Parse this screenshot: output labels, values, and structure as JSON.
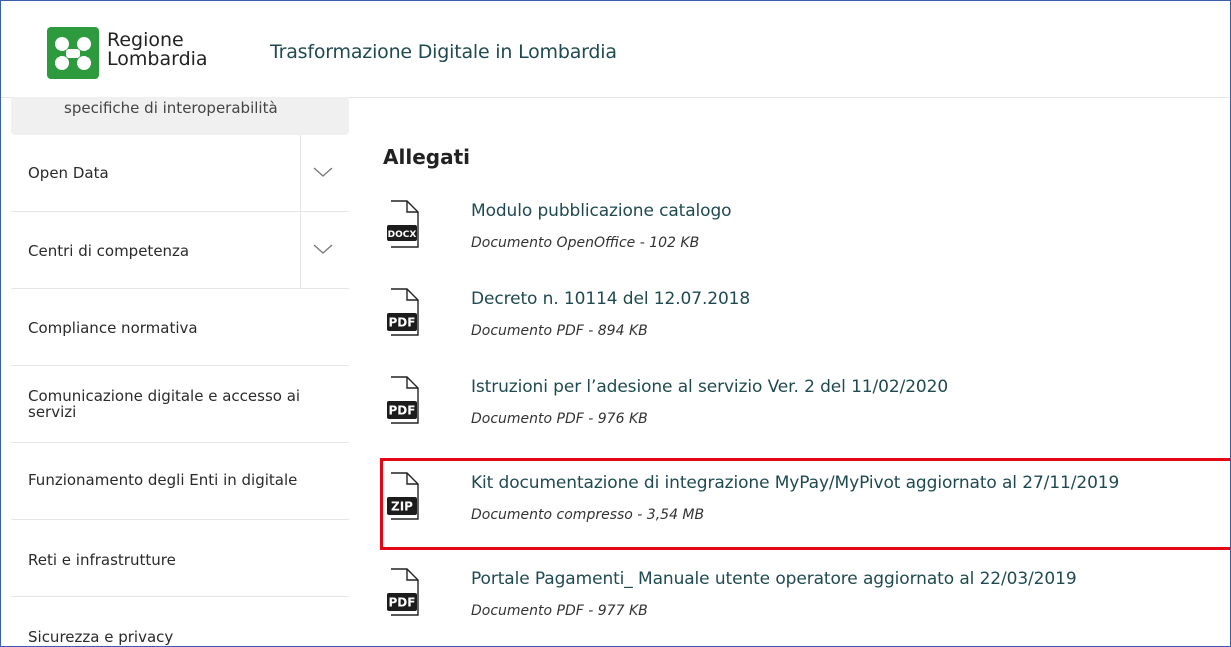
{
  "header": {
    "logo_line1": "Regione",
    "logo_line2": "Lombardia",
    "site_title": "Trasformazione Digitale in Lombardia",
    "logo_color": "#2e9a3e"
  },
  "sidebar": {
    "top_partial": "specifiche di interoperabilità",
    "items": [
      {
        "label": "Open Data",
        "expandable": true
      },
      {
        "label": "Centri di competenza",
        "expandable": true
      },
      {
        "label": "Compliance normativa",
        "expandable": false
      },
      {
        "label": "Comunicazione digitale e accesso ai servizi",
        "expandable": false
      },
      {
        "label": "Funzionamento degli Enti in digitale",
        "expandable": false
      },
      {
        "label": "Reti e infrastrutture",
        "expandable": false
      },
      {
        "label": "Sicurezza e privacy",
        "expandable": false
      }
    ]
  },
  "main": {
    "section_title": "Allegati",
    "attachments": [
      {
        "title": "Modulo pubblicazione catalogo",
        "meta": "Documento OpenOffice - 102 KB",
        "type": "DOCX",
        "icon": "docx-file-icon"
      },
      {
        "title": "Decreto n. 10114 del 12.07.2018",
        "meta": "Documento PDF - 894 KB",
        "type": "PDF",
        "icon": "pdf-file-icon"
      },
      {
        "title": "Istruzioni per l’adesione al servizio Ver. 2 del 11/02/2020",
        "meta": "Documento PDF - 976 KB",
        "type": "PDF",
        "icon": "pdf-file-icon"
      },
      {
        "title": "Kit documentazione di integrazione MyPay/MyPivot aggiornato al 27/11/2019",
        "meta": "Documento compresso - 3,54 MB",
        "type": "ZIP",
        "icon": "zip-file-icon"
      },
      {
        "title": "Portale Pagamenti_ Manuale utente operatore aggiornato al 22/03/2019",
        "meta": "Documento PDF - 977 KB",
        "type": "PDF",
        "icon": "pdf-file-icon"
      }
    ],
    "highlight_color": "#e30613",
    "link_color": "#1f4a51"
  }
}
